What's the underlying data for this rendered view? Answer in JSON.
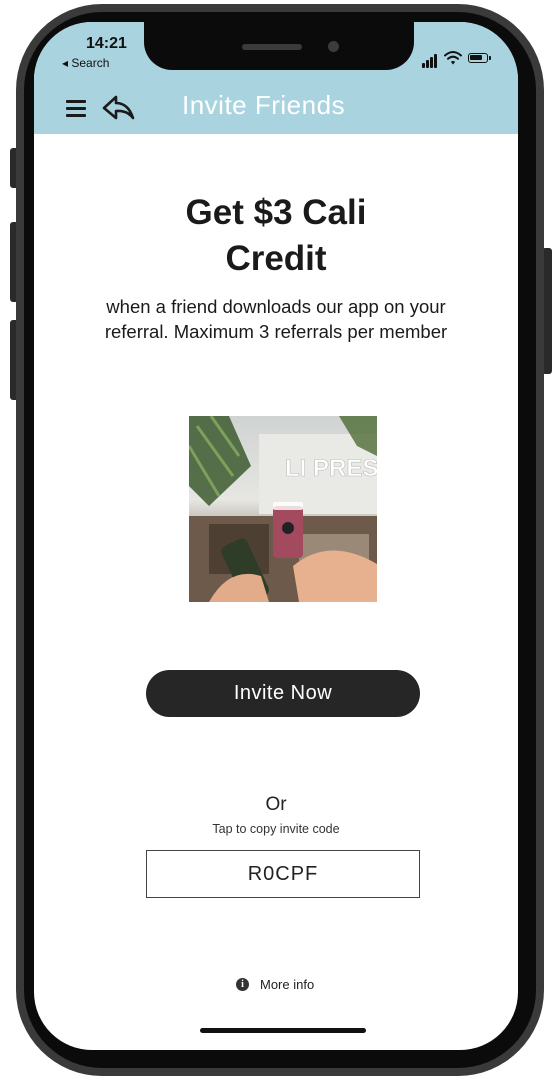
{
  "status_bar": {
    "time": "14:21",
    "back_link": "◂ Search",
    "signal": "signal-icon",
    "wifi": "wifi-icon",
    "battery": "battery-icon"
  },
  "header": {
    "title": "Invite Friends",
    "background": "#a9d3df",
    "menu_icon": "hamburger-menu-icon",
    "back_icon": "back-arrow-icon"
  },
  "content": {
    "headline_line1": "Get $3 Cali",
    "headline_line2": "Credit",
    "subtext_line1": "when a friend downloads our app on your",
    "subtext_line2": "referral. Maximum 3 referrals per member",
    "image_sign_text": "LI PRES",
    "invite_button": "Invite Now",
    "or_text": "Or",
    "copy_hint": "Tap to copy invite code",
    "invite_code": "R0CPF",
    "more_info": "More info",
    "more_info_icon": "info-icon"
  },
  "colors": {
    "accent": "#a9d3df",
    "button": "#262626",
    "text": "#1a1a1a"
  }
}
